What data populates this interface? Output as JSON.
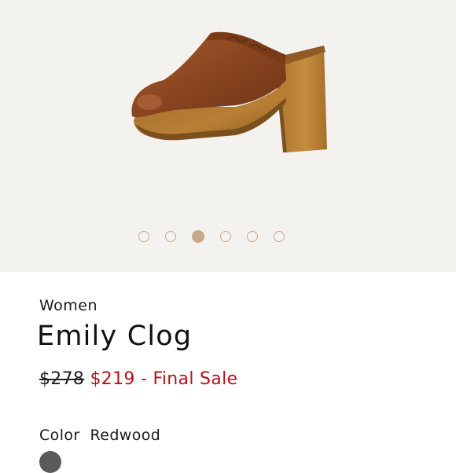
{
  "gallery": {
    "image_alt": "Emily Clog product image",
    "dots_count": 6,
    "active_dot_index": 2,
    "dot_color": "#c7a987",
    "background": "#f4f2ef"
  },
  "product": {
    "category": "Women",
    "name": "Emily Clog",
    "original_price": "$278",
    "sale_price": "$219",
    "sale_note": "- Final Sale",
    "color_label": "Color",
    "color_value": "Redwood"
  },
  "colors": {
    "sale_red": "#b5121b"
  }
}
